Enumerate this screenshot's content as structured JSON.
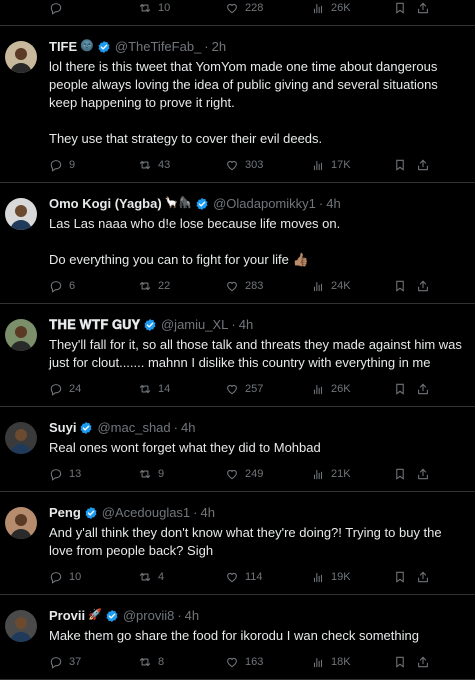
{
  "tweets": [
    {
      "id": "top",
      "name": "",
      "emoji": "",
      "handle": "",
      "time": "",
      "text": "",
      "avatar_color": "#000000",
      "replies": "",
      "retweets": "10",
      "likes": "228",
      "views": "26K"
    },
    {
      "id": "tife",
      "name": "TIFE",
      "emoji": "🌚",
      "handle": "@TheTifeFab_",
      "time": "2h",
      "text": "lol there is this tweet that YomYom made one time about dangerous people always loving the idea of public giving and several situations keep happening to prove it right.\n\nThey use that strategy to cover their evil deeds.",
      "avatar_color": "#c8b89c",
      "replies": "9",
      "retweets": "43",
      "likes": "303",
      "views": "17K"
    },
    {
      "id": "omokogi",
      "name": "Omo Kogi (Yagba)",
      "emoji": "🦙🦍",
      "handle": "@Oladapomikky1",
      "time": "4h",
      "text": "Las Las naaa who d!e lose because life moves on.\n\nDo everything you can to fight for your life 👍🏽",
      "avatar_color": "#d9d9d9",
      "replies": "6",
      "retweets": "22",
      "likes": "283",
      "views": "24K"
    },
    {
      "id": "wtfguy",
      "name": "𝐓𝐇𝐄 𝐖𝐓𝐅 𝐆𝐔𝐘",
      "emoji": "",
      "handle": "@jamiu_XL",
      "time": "4h",
      "text": "They'll fall for it, so all those talk and threats they made against him was just for clout....... mahnn I dislike this country with everything in me",
      "avatar_color": "#7a8f6a",
      "replies": "24",
      "retweets": "14",
      "likes": "257",
      "views": "26K"
    },
    {
      "id": "suyi",
      "name": "Suyi",
      "emoji": "",
      "handle": "@mac_shad",
      "time": "4h",
      "text": "Real ones wont forget what they did to Mohbad",
      "avatar_color": "#3a3a3a",
      "replies": "13",
      "retweets": "9",
      "likes": "249",
      "views": "21K"
    },
    {
      "id": "peng",
      "name": "Peng",
      "emoji": "",
      "handle": "@Acedouglas1",
      "time": "4h",
      "text": "And y'all think they don't know what they're doing?! Trying to buy the love from people back? Sigh",
      "avatar_color": "#b58c6e",
      "replies": "10",
      "retweets": "4",
      "likes": "114",
      "views": "19K"
    },
    {
      "id": "provii",
      "name": "Provii",
      "emoji": "🚀",
      "handle": "@provii8",
      "time": "4h",
      "text": "Make them go share the food for ikorodu I wan check something",
      "avatar_color": "#4a4a4a",
      "replies": "37",
      "retweets": "8",
      "likes": "163",
      "views": "18K"
    }
  ]
}
